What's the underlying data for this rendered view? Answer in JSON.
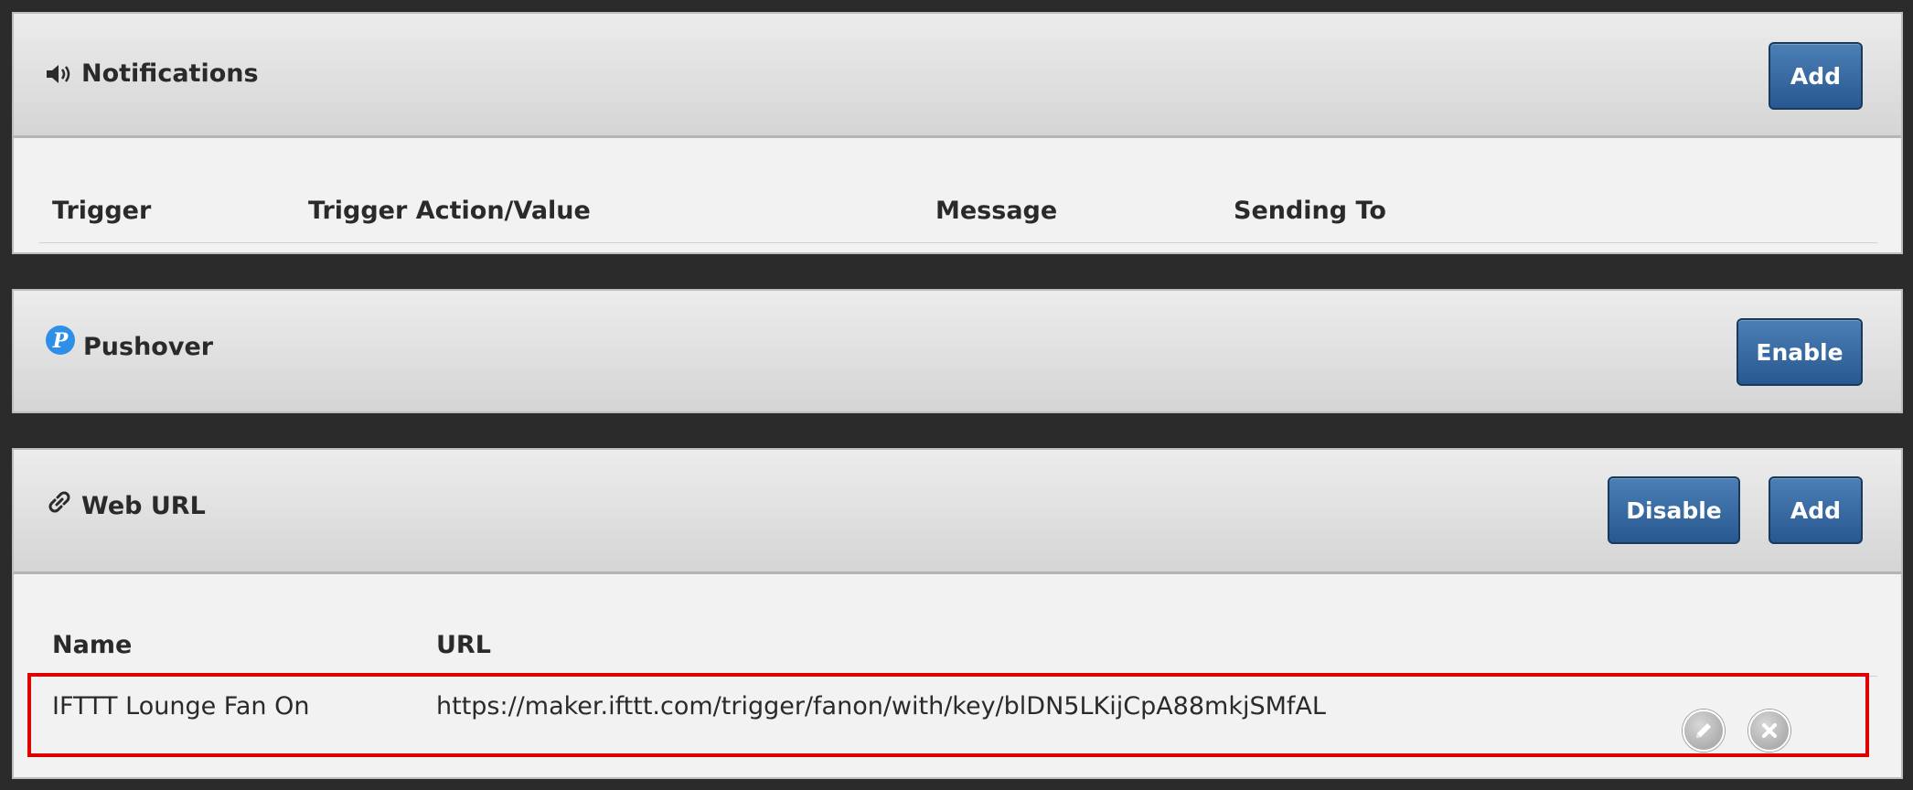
{
  "notifications": {
    "title": "Notifications",
    "icon": "speaker-icon",
    "add_label": "Add",
    "columns": [
      "Trigger",
      "Trigger Action/Value",
      "Message",
      "Sending To"
    ]
  },
  "pushover": {
    "title": "Pushover",
    "icon": "pushover-logo-icon",
    "enable_label": "Enable"
  },
  "weburl": {
    "title": "Web URL",
    "icon": "link-icon",
    "disable_label": "Disable",
    "add_label": "Add",
    "columns": [
      "Name",
      "URL"
    ],
    "rows": [
      {
        "name": "IFTTT Lounge Fan On",
        "url": "https://maker.ifttt.com/trigger/fanon/with/key/blDN5LKijCpA88mkjSMfAL"
      }
    ]
  },
  "colors": {
    "background": "#2b2b2b",
    "button": "#2f5f97",
    "highlight": "#e00000",
    "pushover_blue": "#2f8fe8"
  }
}
